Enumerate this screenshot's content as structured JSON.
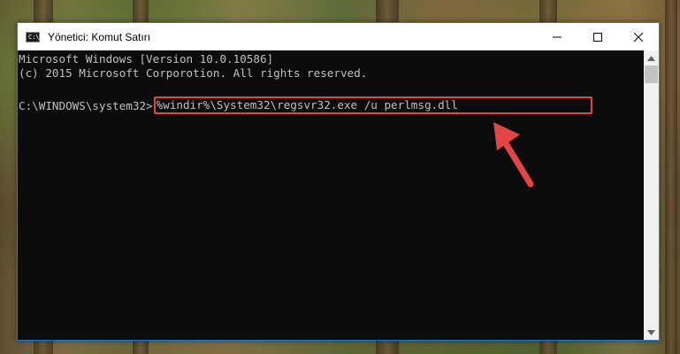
{
  "window": {
    "title": "Yönetici: Komut Satırı"
  },
  "console": {
    "line1": "Microsoft Windows [Version 10.0.10586]",
    "line2": "(c) 2015 Microsoft Corporotion. All rights reserved.",
    "prompt": "C:\\WINDOWS\\system32>",
    "command": "%windir%\\System32\\regsvr32.exe /u perlmsg.dll"
  },
  "colors": {
    "console_bg": "#0c0c0c",
    "console_text": "#c0c0c0",
    "highlight": "#e24545",
    "accent_border": "#1c7ed6"
  },
  "icons": {
    "app": "cmd-icon",
    "minimize": "minimize-icon",
    "maximize": "maximize-icon",
    "close": "close-icon",
    "annotation": "arrow-pointer-icon"
  }
}
